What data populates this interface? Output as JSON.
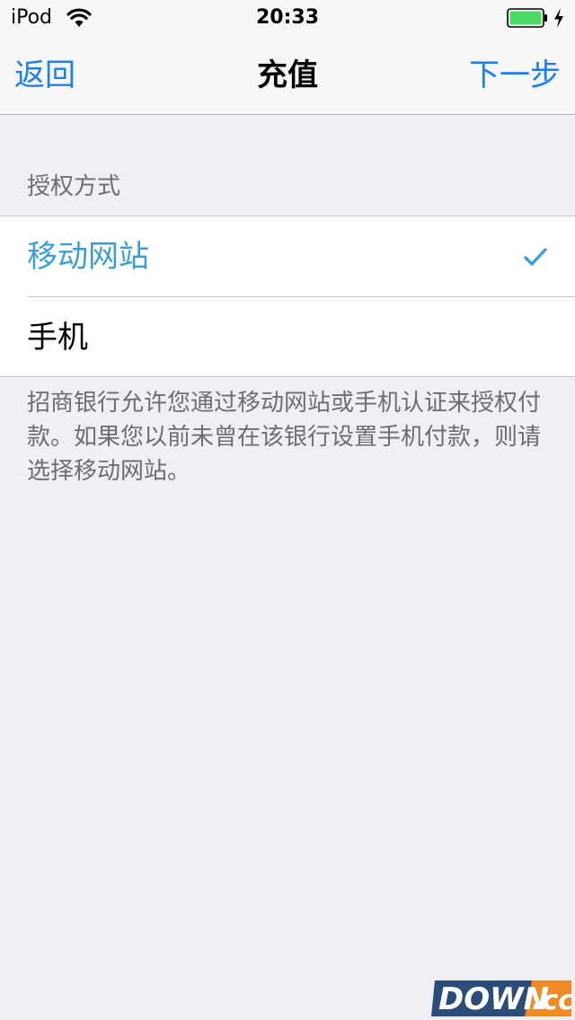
{
  "status_bar": {
    "carrier": "iPod",
    "time": "20:33",
    "wifi_icon": "wifi-icon",
    "battery_icon": "battery-icon",
    "charging_icon": "charging-bolt-icon",
    "battery_color": "#4cd964"
  },
  "nav": {
    "back_label": "返回",
    "title": "充值",
    "next_label": "下一步",
    "accent_color": "#1a7ef4"
  },
  "section": {
    "header": "授权方式",
    "options": [
      {
        "label": "移动网站",
        "selected": true
      },
      {
        "label": "手机",
        "selected": false
      }
    ],
    "selected_color": "#3a9fd7",
    "check_icon": "checkmark-icon"
  },
  "footer": {
    "text": "招商银行允许您通过移动网站或手机认证来授权付款。如果您以前未曾在该银行设置手机付款，则请选择移动网站。"
  },
  "watermark": {
    "text_main": "DOWN",
    "text_suffix": ".cc"
  }
}
